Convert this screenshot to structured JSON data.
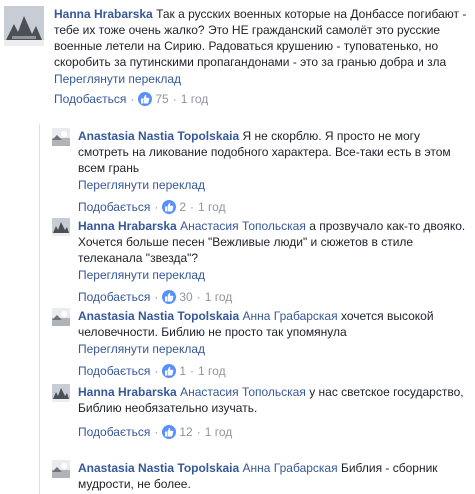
{
  "comments": [
    {
      "author": "Hanna Hrabarska",
      "mention": "",
      "text": "Так а русских военных которые на Донбассе погибают - тебе их тоже очень жалко? Это НЕ гражданский самолёт это русские военные летели на Сирию. Радоваться крушению - туповатенько, но скоробить за путинскими пропагандонами - это за гранью добра и зла",
      "translate": "Переглянути переклад",
      "like_label": "Подобається",
      "likes": "75",
      "time": "1 год"
    },
    {
      "author": "Anastasia Nastia Topolskaia",
      "mention": "",
      "text": "Я не скорблю. Я просто не могу смотреть на ликование подобного характера. Все-таки есть в этом всем грань",
      "translate": "Переглянути переклад",
      "like_label": "Подобається",
      "likes": "2",
      "time": "1 год"
    },
    {
      "author": "Hanna Hrabarska",
      "mention": "Анастасия Топольская",
      "text": "а прозвучало как-то двояко. Хочется больше песен \"Вежливые люди\" и сюжетов в стиле телеканала \"звезда\"?",
      "translate": "Переглянути переклад",
      "like_label": "Подобається",
      "likes": "30",
      "time": "1 год"
    },
    {
      "author": "Anastasia Nastia Topolskaia",
      "mention": "Анна Грабарская",
      "text": "хочется высокой человечности. Библию не просто так упомянула",
      "translate": "Переглянути переклад",
      "like_label": "Подобається",
      "likes": "1",
      "time": "1 год"
    },
    {
      "author": "Hanna Hrabarska",
      "mention": "Анастасия Топольская",
      "text": "у нас светское государство, Библию необязательно изучать.",
      "translate": "",
      "like_label": "Подобається",
      "likes": "12",
      "time": "1 год"
    },
    {
      "author": "Anastasia Nastia Topolskaia",
      "mention": "Анна Грабарская",
      "text": "Библия - сборник мудрости, не более.",
      "translate": "",
      "like_label": "",
      "likes": "",
      "time": ""
    }
  ],
  "colors": {
    "link": "#365899",
    "meta": "#90949c",
    "like_badge": "#5890ff",
    "thread_line": "#dddfe2"
  },
  "icons": {
    "avatar_hanna": "avatar-silhouette-icon",
    "avatar_anastasia": "avatar-landscape-icon",
    "like": "thumbs-up-icon"
  }
}
